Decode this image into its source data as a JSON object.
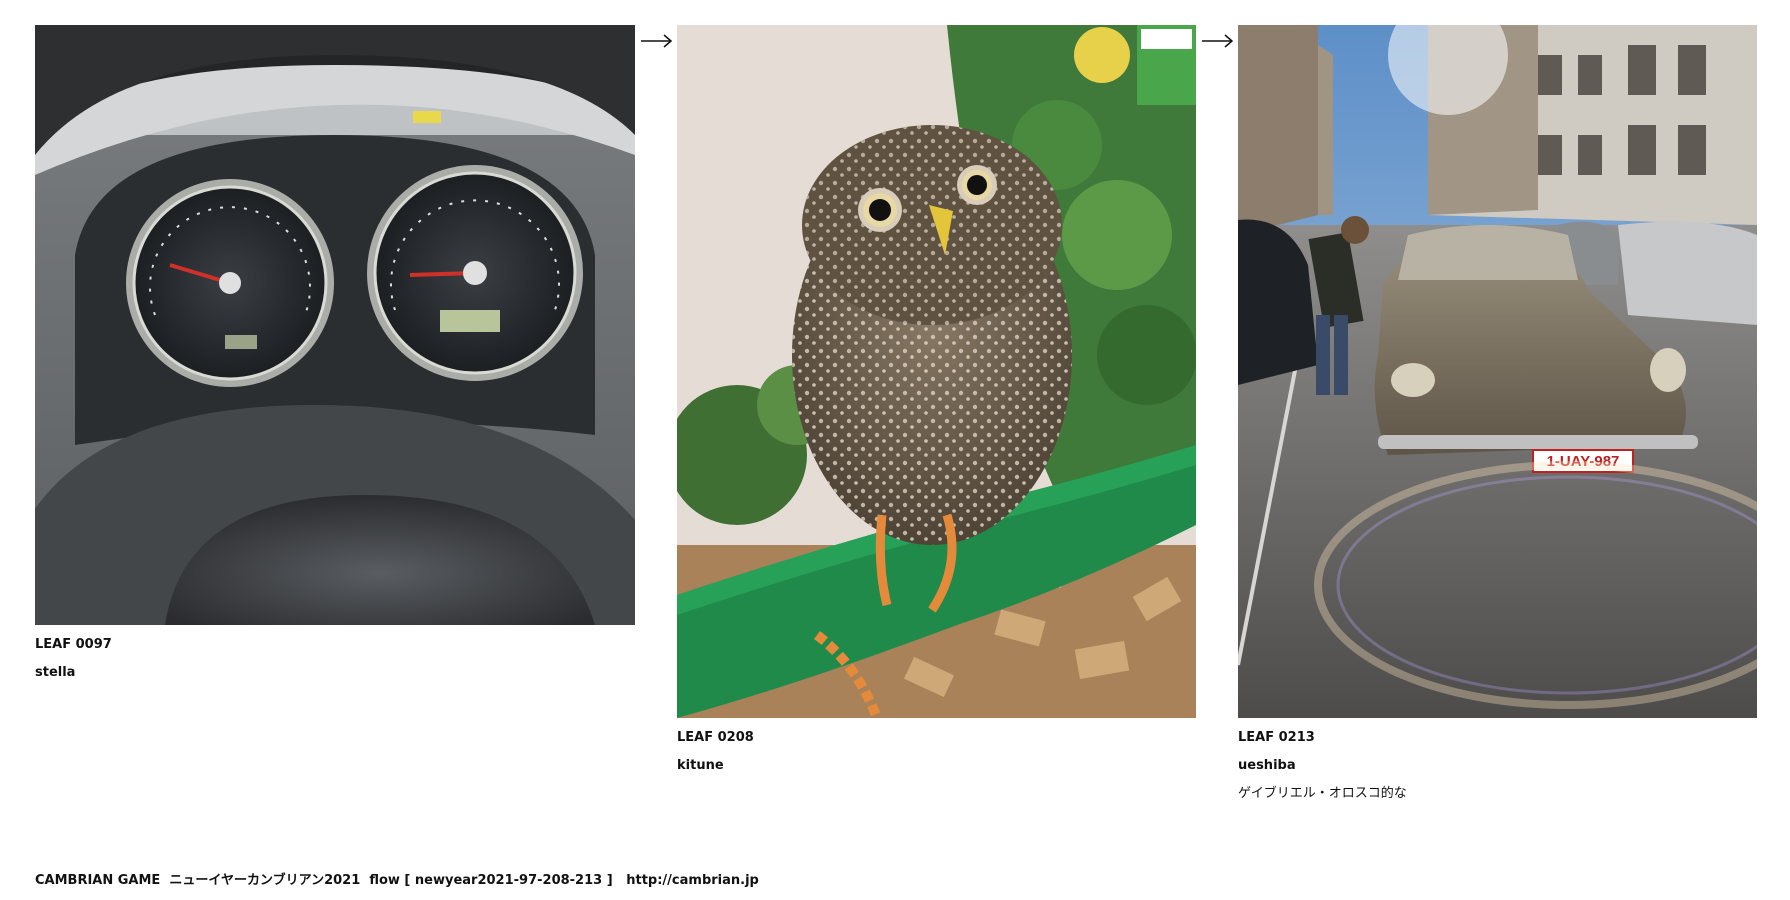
{
  "leaves": [
    {
      "code": "LEAF 0097",
      "author": "stella",
      "note": "",
      "photo": "car-dashboard-photo"
    },
    {
      "code": "LEAF 0208",
      "author": "kitune",
      "note": "",
      "photo": "owl-photo"
    },
    {
      "code": "LEAF 0213",
      "author": "ueshiba",
      "note": "ゲイブリエル・オロスコ的な",
      "photo": "vintage-car-street-photo"
    }
  ],
  "photo_text": {
    "plate": "1-UAY-987"
  },
  "arrows": [
    "arrow-right-icon",
    "arrow-right-icon"
  ],
  "footer": {
    "brand": "CAMBRIAN GAME",
    "title": "ニューイヤーカンブリアン2021",
    "flow": "flow [ newyear2021-97-208-213 ]",
    "url": "http://cambrian.jp"
  }
}
